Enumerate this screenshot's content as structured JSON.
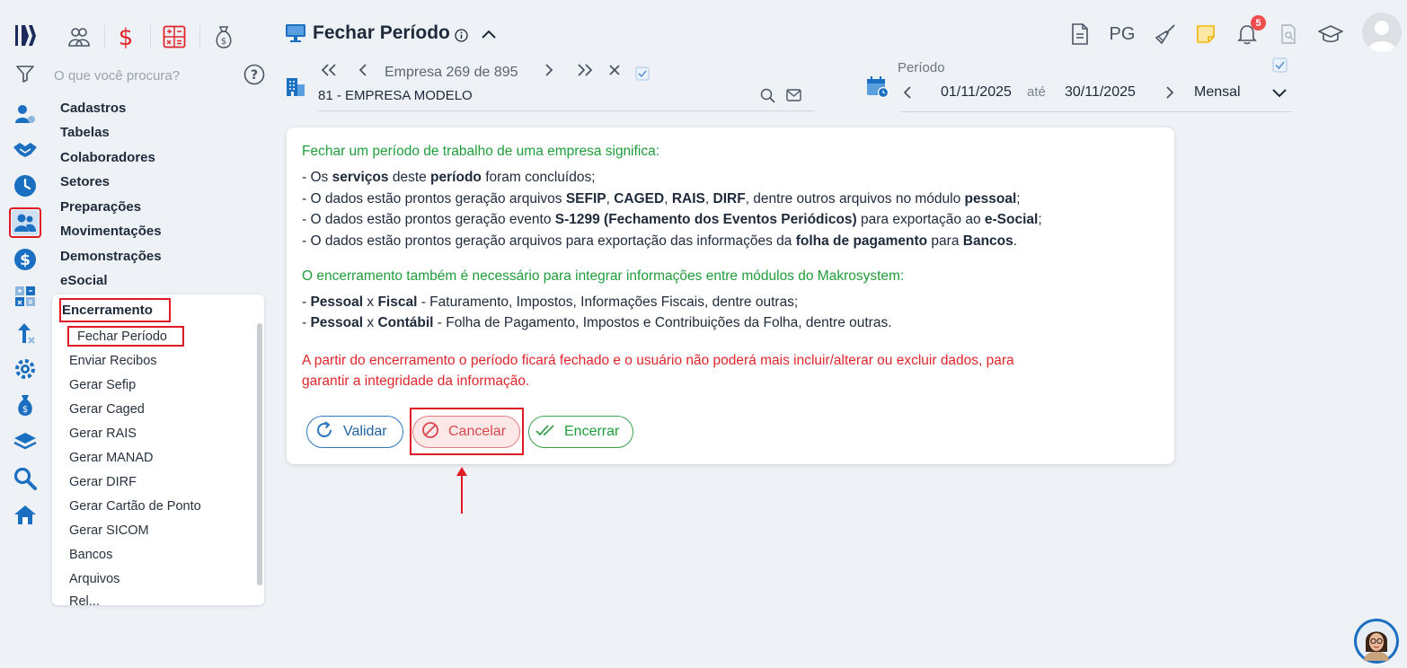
{
  "header": {
    "title": "Fechar Período",
    "pg_label": "PG",
    "notifications_count": "5"
  },
  "search": {
    "placeholder": "O que você procura?"
  },
  "menu": {
    "items": [
      "Cadastros",
      "Tabelas",
      "Colaboradores",
      "Setores",
      "Preparações",
      "Movimentações",
      "Demonstrações",
      "eSocial"
    ],
    "section": "Encerramento",
    "subitems": [
      "Fechar Período",
      "Enviar Recibos",
      "Gerar Sefip",
      "Gerar Caged",
      "Gerar RAIS",
      "Gerar MANAD",
      "Gerar DIRF",
      "Gerar Cartão de Ponto",
      "Gerar SICOM",
      "Bancos",
      "Arquivos",
      "Rel..."
    ],
    "active_subitem": "Fechar Período"
  },
  "empresa": {
    "label": "Empresa 269 de 895",
    "value": "81 - EMPRESA MODELO",
    "checkbox_checked": true
  },
  "periodo": {
    "label": "Período",
    "start": "01/11/2025",
    "between": "até",
    "end": "30/11/2025",
    "mode": "Mensal",
    "checkbox_checked": true
  },
  "card": {
    "intro": "Fechar um período de trabalho de uma empresa significa:",
    "bullets": [
      [
        "- Os ",
        "serviços",
        " deste ",
        "período",
        " foram concluídos;"
      ],
      [
        "- O dados estão prontos geração arquivos ",
        "SEFIP",
        ", ",
        "CAGED",
        ", ",
        "RAIS",
        ", ",
        "DIRF",
        ", dentre outros arquivos no módulo ",
        "pessoal",
        ";"
      ],
      [
        "- O dados estão prontos geração evento ",
        "S-1299 (Fechamento dos Eventos Periódicos)",
        " para exportação ao ",
        "e-Social",
        ";"
      ],
      [
        "- O dados estão prontos geração arquivos para exportação das informações da ",
        "folha de pagamento",
        " para ",
        "Bancos",
        "."
      ]
    ],
    "integration_title": "O encerramento também é necessário para integrar informações entre módulos do Makrosystem:",
    "integrations": [
      [
        "- ",
        "Pessoal",
        " x ",
        "Fiscal",
        " - Faturamento, Impostos, Informações Fiscais, dentre outras;"
      ],
      [
        "- ",
        "Pessoal",
        " x ",
        "Contábil",
        " - Folha de Pagamento, Impostos e Contribuições da Folha, dentre outras."
      ]
    ],
    "warning_line1": "A partir do encerramento o período ficará fechado e o usuário não poderá mais incluir/alterar ou excluir dados, para",
    "warning_line2": "garantir a integridade da informação.",
    "buttons": {
      "validar": "Validar",
      "cancelar": "Cancelar",
      "encerrar": "Encerrar"
    }
  },
  "colors": {
    "accent_blue": "#1b6fc0",
    "success_green": "#1f9d3a",
    "danger_red": "#e0262b",
    "annotation_red": "#e01b24"
  }
}
